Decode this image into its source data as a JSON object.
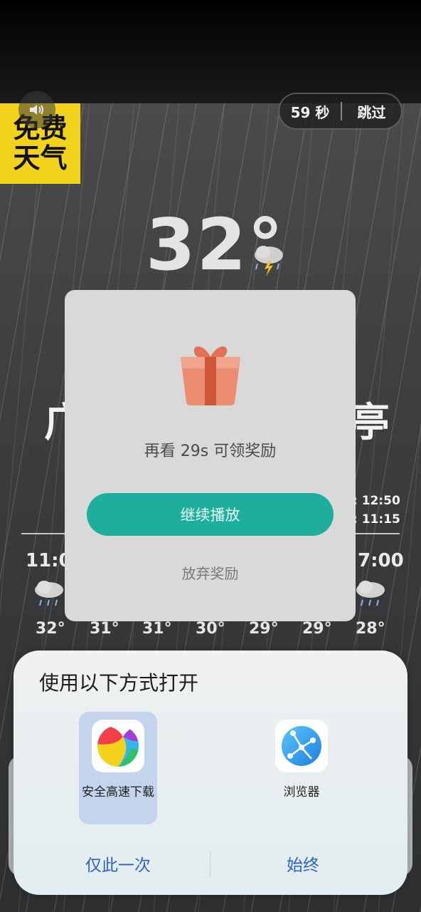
{
  "ad": {
    "brand_line1": "免费",
    "brand_line2": "天气",
    "countdown": "59 秒",
    "skip": "跳过",
    "temperature": "32°",
    "city_left": "广",
    "city_right": "亭",
    "time_1": ": 12:50",
    "time_2": ": 11:15",
    "hour_left": "11:00",
    "hour_right": "7:00",
    "hourly_temps": [
      "32°",
      "31°",
      "31°",
      "30°",
      "29°",
      "29°",
      "28°"
    ]
  },
  "reward_dialog": {
    "message": "再看 29s 可领奖励",
    "continue_label": "继续播放",
    "give_up_label": "放弃奖励"
  },
  "open_with_sheet": {
    "title": "使用以下方式打开",
    "apps": [
      {
        "name": "安全高速下载",
        "icon": "colorful-ball-icon",
        "selected": true
      },
      {
        "name": "浏览器",
        "icon": "browser-icon",
        "selected": false
      }
    ],
    "just_once": "仅此一次",
    "always": "始终"
  },
  "colors": {
    "accent_teal": "#1fae9d",
    "brand_yellow": "#f2d21b",
    "link_blue": "#2d63c8",
    "selected_card": "#c4d4ec"
  }
}
